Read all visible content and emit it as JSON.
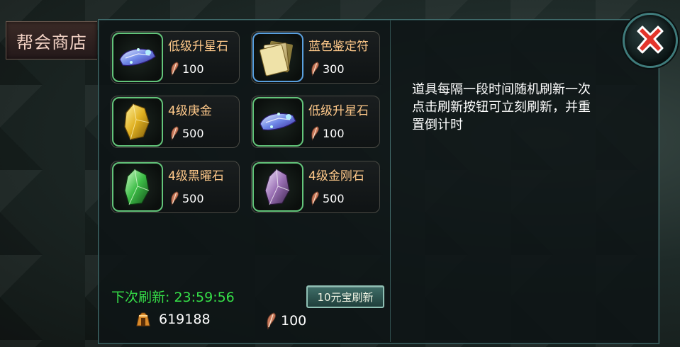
{
  "title": "帮会商店",
  "items": [
    {
      "name": "低级升星石",
      "price": "100",
      "icon": "blue-star-stone-icon",
      "frame": "green"
    },
    {
      "name": "蓝色鉴定符",
      "price": "300",
      "icon": "identify-scroll-icon",
      "frame": "blue"
    },
    {
      "name": "4级庚金",
      "price": "500",
      "icon": "yellow-crystal-icon",
      "frame": "green"
    },
    {
      "name": "低级升星石",
      "price": "100",
      "icon": "blue-star-stone-icon",
      "frame": "green"
    },
    {
      "name": "4级黑曜石",
      "price": "500",
      "icon": "green-crystal-icon",
      "frame": "green"
    },
    {
      "name": "4级金刚石",
      "price": "500",
      "icon": "purple-crystal-icon",
      "frame": "green"
    }
  ],
  "info_lines": [
    "道具每隔一段时间随机刷新一次",
    "点击刷新按钮可立刻刷新，并重",
    "置倒计时"
  ],
  "refresh": {
    "label": "下次刷新: 23:59:56",
    "button": "10元宝刷新"
  },
  "wallet": {
    "gold": "619188",
    "contribution": "100"
  },
  "colors": {
    "item_name": "#ffc98a",
    "refresh_text": "#36e048",
    "frame_green": "#63c47a",
    "frame_blue": "#5aa0de"
  }
}
